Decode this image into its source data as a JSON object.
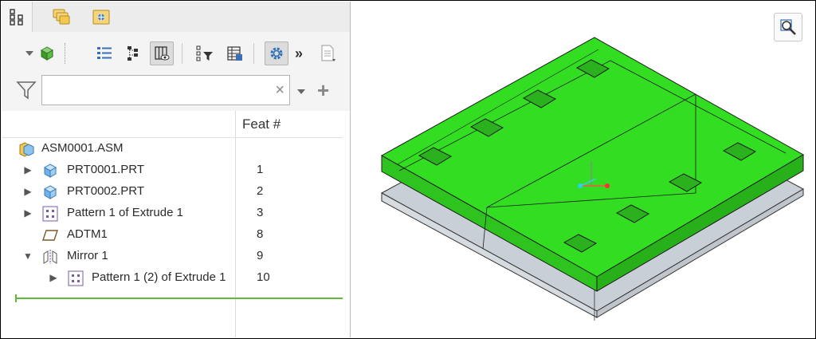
{
  "tree": {
    "column_header": "Feat #",
    "search": {
      "value": "",
      "clear_glyph": "×",
      "add_glyph": "+"
    },
    "toolbar": {
      "more_glyph": "»"
    },
    "rows": [
      {
        "label": "ASM0001.ASM",
        "feat": "",
        "icon": "assembly-icon"
      },
      {
        "label": "PRT0001.PRT",
        "feat": "1",
        "icon": "part-icon"
      },
      {
        "label": "PRT0002.PRT",
        "feat": "2",
        "icon": "part-icon"
      },
      {
        "label": "Pattern 1 of Extrude 1",
        "feat": "3",
        "icon": "pattern-icon"
      },
      {
        "label": "ADTM1",
        "feat": "8",
        "icon": "datum-plane-icon"
      },
      {
        "label": "Mirror 1",
        "feat": "9",
        "icon": "mirror-icon"
      },
      {
        "label": "Pattern 1 (2) of Extrude 1",
        "feat": "10",
        "icon": "pattern-icon"
      }
    ]
  },
  "colors": {
    "model_green": "#33dd22",
    "plate_gray": "#c9cfd6",
    "insert_line": "#5dbb3a"
  }
}
